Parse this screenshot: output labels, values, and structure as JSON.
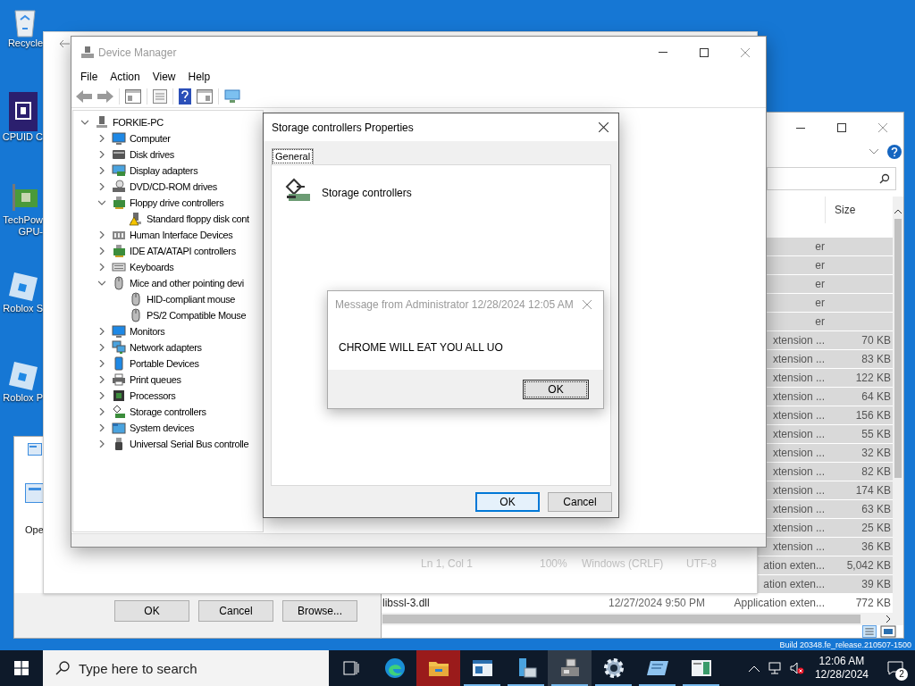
{
  "desktop": {
    "icons": [
      {
        "kind": "recycle-bin",
        "lines": [
          "Recycle"
        ]
      },
      {
        "kind": "chip",
        "lines": [
          "CPUID C"
        ]
      },
      {
        "kind": "card",
        "lines": [
          "TechPow",
          "GPU-"
        ]
      },
      {
        "kind": "tile",
        "lines": [
          "Roblox S"
        ]
      },
      {
        "kind": "tile",
        "lines": [
          "Roblox P"
        ]
      }
    ],
    "build_text": "Build 20348.fe_release.210507-1500"
  },
  "explorer": {
    "columns": [
      {
        "label": "Size"
      }
    ],
    "rows": [
      {
        "type": "er",
        "selected": true
      },
      {
        "type": "er",
        "selected": true
      },
      {
        "type": "er",
        "selected": true
      },
      {
        "type": "er",
        "selected": true
      },
      {
        "type": "er",
        "selected": true
      },
      {
        "type": "xtension ...",
        "size": "70 KB",
        "selected": true
      },
      {
        "type": "xtension ...",
        "size": "83 KB",
        "selected": true
      },
      {
        "type": "xtension ...",
        "size": "122 KB",
        "selected": true
      },
      {
        "type": "xtension ...",
        "size": "64 KB",
        "selected": true
      },
      {
        "type": "xtension ...",
        "size": "156 KB",
        "selected": true
      },
      {
        "type": "xtension ...",
        "size": "55 KB",
        "selected": true
      },
      {
        "type": "xtension ...",
        "size": "32 KB",
        "selected": true
      },
      {
        "type": "xtension ...",
        "size": "82 KB",
        "selected": true
      },
      {
        "type": "xtension ...",
        "size": "174 KB",
        "selected": true
      },
      {
        "type": "xtension ...",
        "size": "63 KB",
        "selected": true
      },
      {
        "type": "xtension ...",
        "size": "25 KB",
        "selected": true
      },
      {
        "type": "xtension ...",
        "size": "36 KB",
        "selected": true
      },
      {
        "type": "ation exten...",
        "size": "5,042 KB",
        "selected": true
      },
      {
        "type": "ation exten...",
        "size": "39 KB",
        "selected": true
      },
      {
        "name": "libssl-3.dll",
        "date": "12/27/2024 9:50 PM",
        "type": "Application exten...",
        "size": "772 KB",
        "selected": false
      }
    ]
  },
  "notepad_window": {
    "status": [
      "Ln 1, Col 1",
      "100%",
      "Windows (CRLF)",
      "UTF-8"
    ]
  },
  "run_dialog": {
    "label": "Ope",
    "buttons": [
      "OK",
      "Cancel",
      "Browse..."
    ]
  },
  "device_manager": {
    "title": "Device Manager",
    "menu": [
      "File",
      "Action",
      "View",
      "Help"
    ],
    "tree": {
      "label": "FORKIE-PC",
      "kind": "computer",
      "expanded": true,
      "children": [
        {
          "label": "Computer",
          "kind": "monitor",
          "expanded": false
        },
        {
          "label": "Disk drives",
          "kind": "disk",
          "expanded": false
        },
        {
          "label": "Display adapters",
          "kind": "display",
          "expanded": false
        },
        {
          "label": "DVD/CD-ROM drives",
          "kind": "dvd",
          "expanded": false
        },
        {
          "label": "Floppy drive controllers",
          "kind": "card",
          "expanded": true,
          "children": [
            {
              "label": "Standard floppy disk cont",
              "kind": "computer",
              "warning": true
            }
          ]
        },
        {
          "label": "Human Interface Devices",
          "kind": "hid",
          "expanded": false
        },
        {
          "label": "IDE ATA/ATAPI controllers",
          "kind": "card",
          "expanded": false
        },
        {
          "label": "Keyboards",
          "kind": "keyboard",
          "expanded": false
        },
        {
          "label": "Mice and other pointing devi",
          "kind": "mouse",
          "expanded": true,
          "children": [
            {
              "label": "HID-compliant mouse",
              "kind": "mouse"
            },
            {
              "label": "PS/2 Compatible Mouse",
              "kind": "mouse"
            }
          ]
        },
        {
          "label": "Monitors",
          "kind": "monitor",
          "expanded": false
        },
        {
          "label": "Network adapters",
          "kind": "network",
          "expanded": false
        },
        {
          "label": "Portable Devices",
          "kind": "portable",
          "expanded": false
        },
        {
          "label": "Print queues",
          "kind": "printer",
          "expanded": false
        },
        {
          "label": "Processors",
          "kind": "processor",
          "expanded": false
        },
        {
          "label": "Storage controllers",
          "kind": "storage",
          "expanded": false
        },
        {
          "label": "System devices",
          "kind": "system",
          "expanded": false
        },
        {
          "label": "Universal Serial Bus controlle",
          "kind": "usb",
          "expanded": false
        }
      ]
    }
  },
  "properties_dialog": {
    "title": "Storage controllers Properties",
    "tabs": [
      {
        "label": "General",
        "selected": true
      }
    ],
    "device_name": "Storage controllers",
    "buttons": [
      {
        "label": "OK",
        "default": true
      },
      {
        "label": "Cancel",
        "default": false
      }
    ]
  },
  "message_box": {
    "title": "Message from Administrator 12/28/2024 12:05 AM",
    "message": "CHROME WILL EAT YOU ALL UO",
    "button": "OK"
  },
  "taskbar": {
    "search_placeholder": "Type here to search",
    "apps": [
      {
        "kind": "task-view",
        "selected": false,
        "running": false,
        "flashing": false
      },
      {
        "kind": "edge",
        "selected": false,
        "running": false,
        "flashing": false
      },
      {
        "kind": "folder",
        "selected": false,
        "running": false,
        "flashing": true
      },
      {
        "kind": "window",
        "selected": false,
        "running": true,
        "flashing": false
      },
      {
        "kind": "server",
        "selected": false,
        "running": true,
        "flashing": false
      },
      {
        "kind": "device-manager",
        "selected": true,
        "running": true,
        "flashing": false
      },
      {
        "kind": "gear",
        "selected": false,
        "running": true,
        "flashing": false
      },
      {
        "kind": "notepad",
        "selected": false,
        "running": true,
        "flashing": false
      },
      {
        "kind": "app",
        "selected": false,
        "running": true,
        "flashing": false
      }
    ],
    "time": "12:06 AM",
    "date": "12/28/2024",
    "notifications": "2"
  }
}
